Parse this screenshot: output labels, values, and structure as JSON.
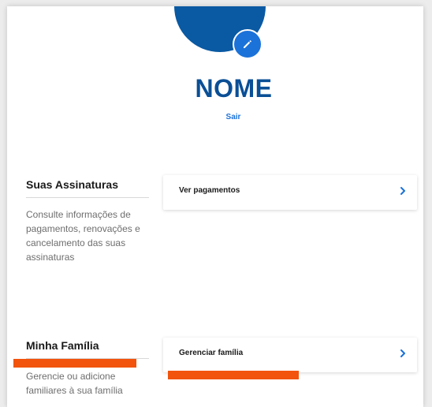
{
  "profile": {
    "name": "NOME",
    "logout_label": "Sair",
    "edit_icon": "pencil-icon"
  },
  "subscriptions": {
    "title": "Suas Assinaturas",
    "description": "Consulte informações de pagamentos, renovações e cancelamento das suas assinaturas",
    "action_label": "Ver pagamentos",
    "action_icon": "chevron-right-icon"
  },
  "family": {
    "title": "Minha Família",
    "description": "Gerencie ou adicione familiares à sua família",
    "action_label": "Gerenciar família",
    "action_icon": "chevron-right-icon"
  },
  "colors": {
    "avatar": "#0a59a3",
    "accent": "#1b72d9",
    "name": "#0a4f96",
    "redaction": "#f2540d"
  }
}
